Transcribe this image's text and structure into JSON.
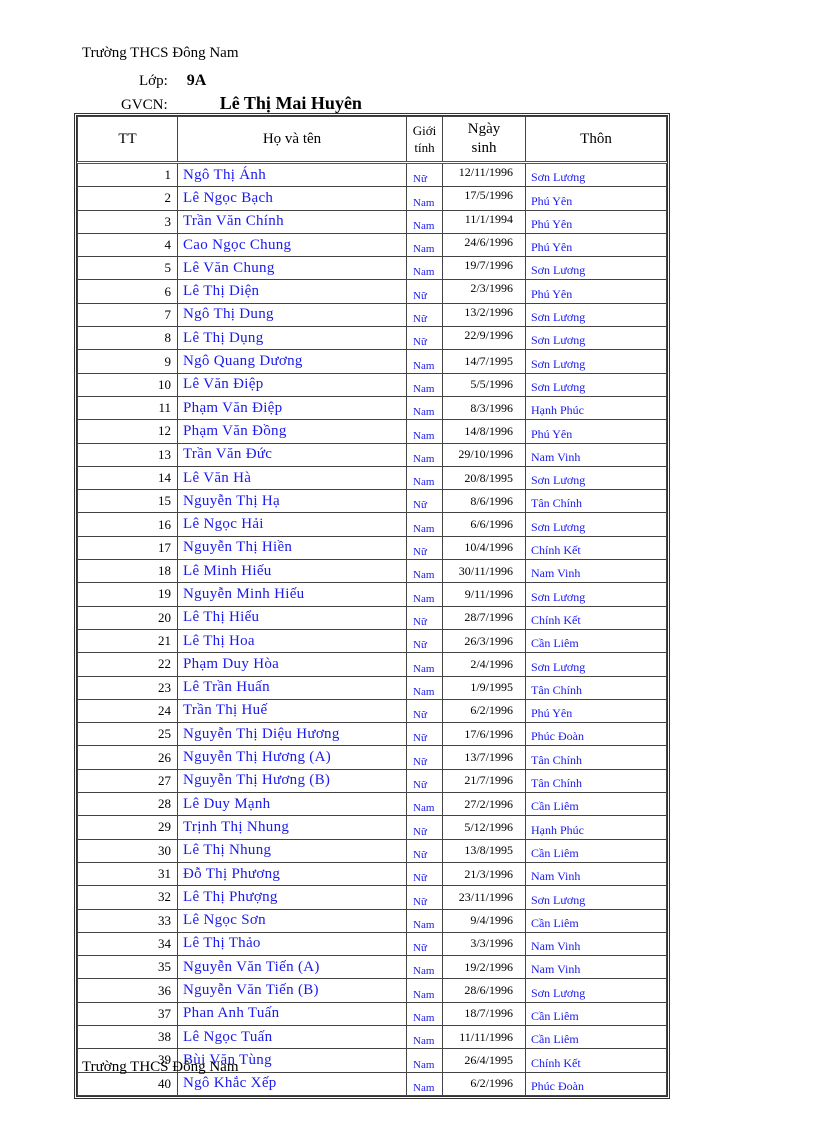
{
  "header": {
    "school": "Trường THCS Đông Nam",
    "class_label": "Lớp:",
    "class_value": "9A",
    "teacher_label": "GVCN:",
    "teacher_name": "Lê Thị Mai Huyên"
  },
  "table": {
    "columns": {
      "tt": "TT",
      "name": "Họ và tên",
      "gender_line1": "Giới",
      "gender_line2": "tính",
      "dob_line1": "Ngày",
      "dob_line2": "sinh",
      "village": "Thôn"
    },
    "rows": [
      {
        "tt": "1",
        "name": "Ngô Thị Ánh",
        "gender": "Nữ",
        "dob": "12/11/1996",
        "village": "Sơn Lương"
      },
      {
        "tt": "2",
        "name": "Lê Ngọc Bạch",
        "gender": "Nam",
        "dob": "17/5/1996",
        "village": "Phú Yên"
      },
      {
        "tt": "3",
        "name": "Trần Văn Chính",
        "gender": "Nam",
        "dob": "11/1/1994",
        "village": "Phú Yên"
      },
      {
        "tt": "4",
        "name": "Cao Ngọc Chung",
        "gender": "Nam",
        "dob": "24/6/1996",
        "village": "Phú Yên"
      },
      {
        "tt": "5",
        "name": "Lê Văn Chung",
        "gender": "Nam",
        "dob": "19/7/1996",
        "village": "Sơn Lương"
      },
      {
        "tt": "6",
        "name": "Lê Thị Diện",
        "gender": "Nữ",
        "dob": "2/3/1996",
        "village": "Phú Yên"
      },
      {
        "tt": "7",
        "name": "Ngô Thị Dung",
        "gender": "Nữ",
        "dob": "13/2/1996",
        "village": "Sơn Lương"
      },
      {
        "tt": "8",
        "name": "Lê Thị  Dụng",
        "gender": "Nữ",
        "dob": "22/9/1996",
        "village": "Sơn Lương"
      },
      {
        "tt": "9",
        "name": "Ngô Quang Dương",
        "gender": "Nam",
        "dob": "14/7/1995",
        "village": "Sơn Lương"
      },
      {
        "tt": "10",
        "name": "Lê Văn Điệp",
        "gender": "Nam",
        "dob": "5/5/1996",
        "village": "Sơn Lương"
      },
      {
        "tt": "11",
        "name": "Phạm Văn Điệp",
        "gender": "Nam",
        "dob": "8/3/1996",
        "village": "Hạnh Phúc"
      },
      {
        "tt": "12",
        "name": "Phạm Văn Đồng",
        "gender": "Nam",
        "dob": "14/8/1996",
        "village": "Phú Yên"
      },
      {
        "tt": "13",
        "name": "Trần Văn Đức",
        "gender": "Nam",
        "dob": "29/10/1996",
        "village": "Nam Vinh"
      },
      {
        "tt": "14",
        "name": "Lê Văn Hà",
        "gender": "Nam",
        "dob": "20/8/1995",
        "village": "Sơn Lương"
      },
      {
        "tt": "15",
        "name": "Nguyễn Thị Hạ",
        "gender": "Nữ",
        "dob": "8/6/1996",
        "village": "Tân Chính"
      },
      {
        "tt": "16",
        "name": "Lê Ngọc Hải",
        "gender": "Nam",
        "dob": "6/6/1996",
        "village": "Sơn Lương"
      },
      {
        "tt": "17",
        "name": "Nguyễn Thị Hiền",
        "gender": "Nữ",
        "dob": "10/4/1996",
        "village": "Chính Kết"
      },
      {
        "tt": "18",
        "name": "Lê Minh Hiếu",
        "gender": "Nam",
        "dob": "30/11/1996",
        "village": "Nam Vinh"
      },
      {
        "tt": "19",
        "name": "Nguyễn Minh Hiếu",
        "gender": "Nam",
        "dob": "9/11/1996",
        "village": "Sơn Lương"
      },
      {
        "tt": "20",
        "name": "Lê Thị Hiểu",
        "gender": "Nữ",
        "dob": "28/7/1996",
        "village": "Chính Kết"
      },
      {
        "tt": "21",
        "name": "Lê Thị Hoa",
        "gender": "Nữ",
        "dob": "26/3/1996",
        "village": "Cần Liêm"
      },
      {
        "tt": "22",
        "name": "Phạm Duy Hòa",
        "gender": "Nam",
        "dob": "2/4/1996",
        "village": "Sơn Lương"
      },
      {
        "tt": "23",
        "name": "Lê Trần Huấn",
        "gender": "Nam",
        "dob": "1/9/1995",
        "village": "Tân Chính"
      },
      {
        "tt": "24",
        "name": "Trần Thị Huế",
        "gender": "Nữ",
        "dob": "6/2/1996",
        "village": "Phú Yên"
      },
      {
        "tt": "25",
        "name": "Nguyễn Thị Diệu Hương",
        "gender": "Nữ",
        "dob": "17/6/1996",
        "village": "Phúc Đoàn"
      },
      {
        "tt": "26",
        "name": "Nguyễn Thị Hương (A)",
        "gender": "Nữ",
        "dob": "13/7/1996",
        "village": "Tân Chính"
      },
      {
        "tt": "27",
        "name": "Nguyễn Thị Hương (B)",
        "gender": "Nữ",
        "dob": "21/7/1996",
        "village": "Tân Chính"
      },
      {
        "tt": "28",
        "name": "Lê Duy Mạnh",
        "gender": "Nam",
        "dob": "27/2/1996",
        "village": "Cần Liêm"
      },
      {
        "tt": "29",
        "name": "Trịnh Thị Nhung",
        "gender": "Nữ",
        "dob": "5/12/1996",
        "village": "Hạnh Phúc"
      },
      {
        "tt": "30",
        "name": "Lê Thị Nhung",
        "gender": "Nữ",
        "dob": "13/8/1995",
        "village": "Cần Liêm"
      },
      {
        "tt": "31",
        "name": "Đỗ Thị Phương",
        "gender": "Nữ",
        "dob": "21/3/1996",
        "village": "Nam Vinh"
      },
      {
        "tt": "32",
        "name": "Lê Thị Phượng",
        "gender": "Nữ",
        "dob": "23/11/1996",
        "village": "Sơn Lương"
      },
      {
        "tt": "33",
        "name": "Lê Ngọc Sơn",
        "gender": "Nam",
        "dob": "9/4/1996",
        "village": "Cần Liêm"
      },
      {
        "tt": "34",
        "name": "Lê Thị Thảo",
        "gender": "Nữ",
        "dob": "3/3/1996",
        "village": "Nam Vinh"
      },
      {
        "tt": "35",
        "name": "Nguyễn Văn Tiến (A)",
        "gender": "Nam",
        "dob": "19/2/1996",
        "village": "Nam Vinh"
      },
      {
        "tt": "36",
        "name": "Nguyễn Văn Tiến (B)",
        "gender": "Nam",
        "dob": "28/6/1996",
        "village": "Sơn Lương"
      },
      {
        "tt": "37",
        "name": "Phan Anh Tuấn",
        "gender": "Nam",
        "dob": "18/7/1996",
        "village": "Cần Liêm"
      },
      {
        "tt": "38",
        "name": "Lê Ngọc Tuấn",
        "gender": "Nam",
        "dob": "11/11/1996",
        "village": "Cần Liêm"
      },
      {
        "tt": "39",
        "name": "Bùi Văn Tùng",
        "gender": "Nam",
        "dob": "26/4/1995",
        "village": "Chính Kết"
      },
      {
        "tt": "40",
        "name": "Ngô Khắc Xếp",
        "gender": "Nam",
        "dob": "6/2/1996",
        "village": "Phúc Đoàn"
      }
    ]
  },
  "footer": {
    "school": "Trường THCS Đông Nam"
  }
}
